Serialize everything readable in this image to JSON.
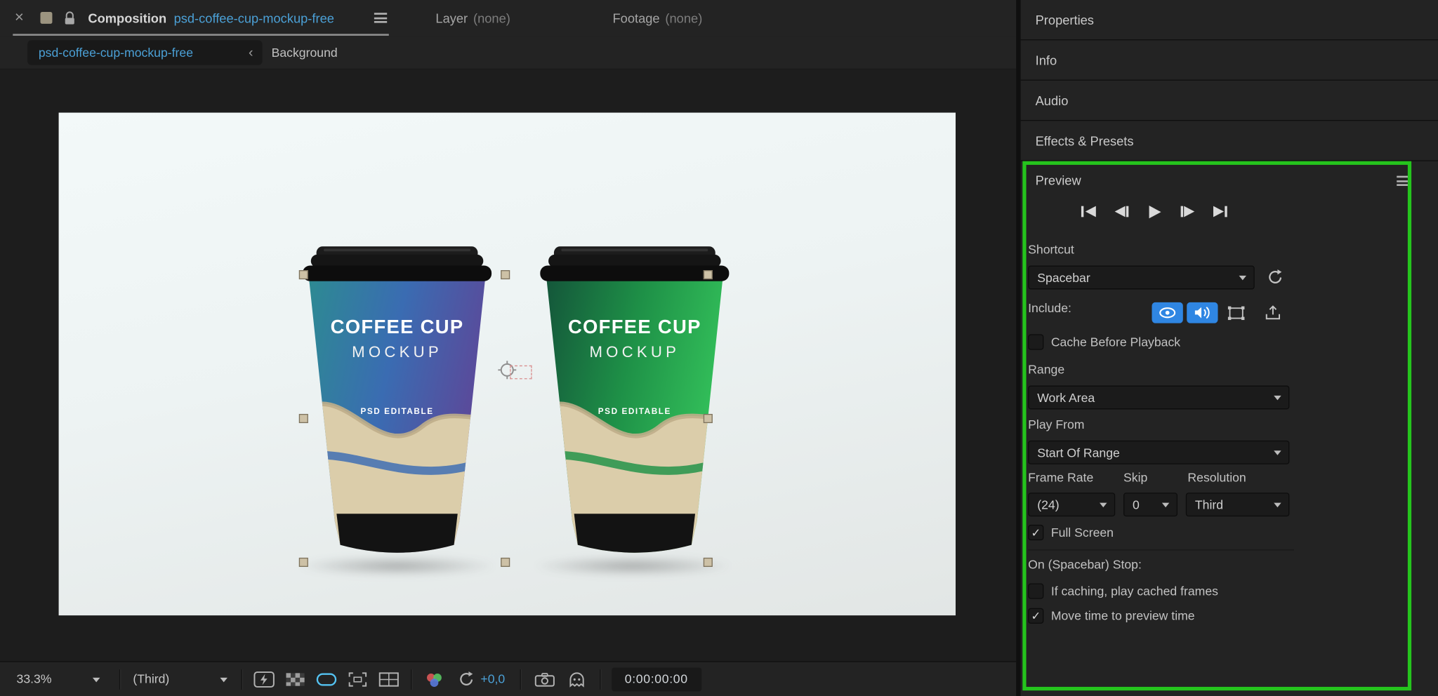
{
  "colors": {
    "highlight_blue": "#4ba0d6",
    "toggle_blue": "#2f86e3",
    "annotation_green": "#25c41d"
  },
  "tabbar": {
    "close": "×",
    "composition_label": "Composition",
    "composition_name": "psd-coffee-cup-mockup-free",
    "layer_label": "Layer",
    "layer_value": "(none)",
    "footage_label": "Footage",
    "footage_value": "(none)"
  },
  "breadcrumb": {
    "comp_name": "psd-coffee-cup-mockup-free",
    "back_chevron": "‹",
    "layer_name": "Background"
  },
  "canvas": {
    "cups": [
      {
        "line1": "COFFEE CUP",
        "line2": "MOCKUP",
        "badge": "PSD EDITABLE"
      },
      {
        "line1": "COFFEE CUP",
        "line2": "MOCKUP",
        "badge": "PSD EDITABLE"
      }
    ]
  },
  "toolbar": {
    "zoom": "33.3%",
    "resolution": "(Third)",
    "exposure_offset": "+0,0",
    "timecode": "0:00:00:00"
  },
  "dock": {
    "panels": [
      "Properties",
      "Info",
      "Audio",
      "Effects & Presets"
    ]
  },
  "preview": {
    "title": "Preview",
    "shortcut_label": "Shortcut",
    "shortcut_value": "Spacebar",
    "include_label": "Include:",
    "cache_before_playback": "Cache Before Playback",
    "range_label": "Range",
    "range_value": "Work Area",
    "play_from_label": "Play From",
    "play_from_value": "Start Of Range",
    "frame_rate_label": "Frame Rate",
    "frame_rate_value": "(24)",
    "skip_label": "Skip",
    "skip_value": "0",
    "resolution_label": "Resolution",
    "resolution_value": "Third",
    "full_screen": "Full Screen",
    "on_stop_label": "On (Spacebar) Stop:",
    "if_caching": "If caching, play cached frames",
    "move_time": "Move time to preview time",
    "checks": {
      "cache": "",
      "full_screen": "✓",
      "if_caching": "",
      "move_time": "✓"
    }
  }
}
